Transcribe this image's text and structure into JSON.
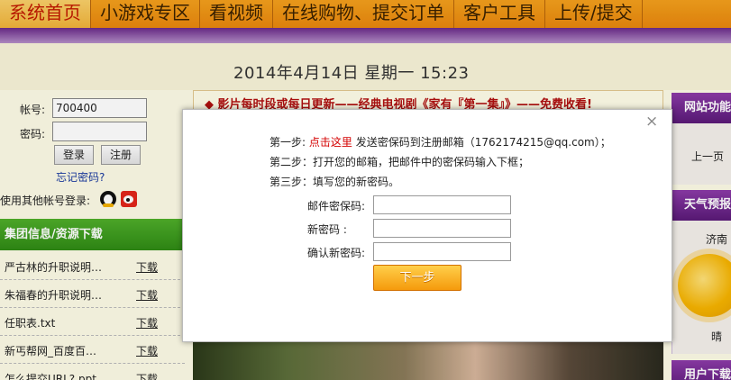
{
  "nav": {
    "items": [
      {
        "label": "系统首页",
        "active": true
      },
      {
        "label": "小游戏专区",
        "active": false
      },
      {
        "label": "看视频",
        "active": false
      },
      {
        "label": "在线购物、提交订单",
        "active": false
      },
      {
        "label": "客户工具",
        "active": false
      },
      {
        "label": "上传/提交",
        "active": false
      },
      {
        "label": "",
        "active": false
      }
    ]
  },
  "date": "2014年4月14日  星期一  15:23",
  "login": {
    "account_label": "帐号:",
    "account_value": "700400",
    "password_label": "密码:",
    "login_button": "登录",
    "register_button": "注册",
    "forgot_link": "忘记密码?",
    "other_login_label": "使用其他帐号登录:",
    "icons": [
      "qq-icon",
      "weibo-icon"
    ]
  },
  "resources": {
    "header": "集团信息/资源下载",
    "download_label": "下载",
    "items": [
      "严古林的升职说明…",
      "朱福春的升职说明…",
      "任职表.txt",
      "新丐帮网_百度百…",
      "怎么提交URL?.ppt"
    ]
  },
  "marquee": "◆ 影片每时段或每日更新——经典电视剧《家有『第一集』》——免费收看!",
  "sidebar": {
    "site_func_header": "网站功能",
    "prev_page": "上一页",
    "weather_header": "天气预报",
    "city": "济南",
    "weather": "晴",
    "user_header": "用户下载"
  },
  "modal": {
    "close_symbol": "×",
    "step1_prefix": "第一步:",
    "step1_link": "点击这里",
    "step1_suffix": "发送密保码到注册邮箱（1762174215@qq.com）；",
    "step2": "第二步：打开您的邮箱，把邮件中的密保码输入下框；",
    "step3": "第三步：填写您的新密码。",
    "field_code_label": "邮件密保码:",
    "field_newpass_label": "新密码    :",
    "field_confirm_label": "确认新密码:",
    "next_button": "下一步"
  },
  "colors": {
    "nav_orange": "#f4a01d",
    "purple": "#6a2a8a",
    "green_header": "#3e9c20",
    "button_orange": "#f59a0c",
    "link_red": "#d40000"
  }
}
